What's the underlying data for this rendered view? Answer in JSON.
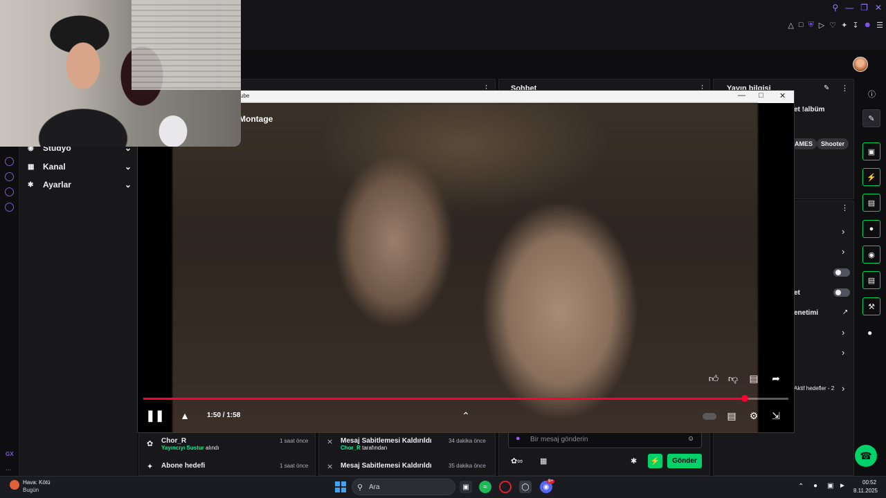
{
  "nav": {
    "items": [
      {
        "label": "Stüdyo",
        "icon": "studio-icon"
      },
      {
        "label": "Kanal",
        "icon": "channel-icon"
      },
      {
        "label": "Ayarlar",
        "icon": "settings-icon"
      }
    ]
  },
  "panels": {
    "chat_title": "Sohbet",
    "info_title": "Yayın bilgisi"
  },
  "info": {
    "title_fragment": "et !albüm",
    "tags": [
      "AMES",
      "Shooter"
    ],
    "row_text_1": "et",
    "row_text_2": "enetimi",
    "goals_label": "Aktif hedefler - 2"
  },
  "video": {
    "window_title": "ube",
    "title": "Montage",
    "time": "1:50 / 1:58",
    "progress": 0.932
  },
  "events_left": [
    {
      "title": "Chor_R",
      "sub_name": "Yayıncıyı Sustur",
      "sub_text": " alındı",
      "time": "1 saat önce"
    },
    {
      "title": "Abone hedefi",
      "sub_name": "",
      "sub_text": "",
      "time": "1 saat önce"
    }
  ],
  "events_mid": [
    {
      "title": "Mesaj Sabitlemesi Kaldırıldı",
      "sub_name": "Chor_R",
      "sub_text": " tarafından",
      "time": "34 dakika önce"
    },
    {
      "title": "Mesaj Sabitlemesi Kaldırıldı",
      "sub_name": "",
      "sub_text": "",
      "time": "35 dakika önce"
    }
  ],
  "chat": {
    "placeholder": "Bir mesaj gönderin",
    "send_label": "Gönder"
  },
  "taskbar": {
    "weather_title": "Hava: Kötü",
    "weather_sub": "Bugün",
    "search_label": "Ara",
    "time": "00:52",
    "date": "8.11.2025",
    "discord_badge": "9+"
  },
  "rail": {
    "gx_label": "GX",
    "dots_label": "..."
  },
  "colors": {
    "accent_green": "#00d26a",
    "accent_purple": "#8a5cff",
    "progress_red": "#ff0033"
  }
}
